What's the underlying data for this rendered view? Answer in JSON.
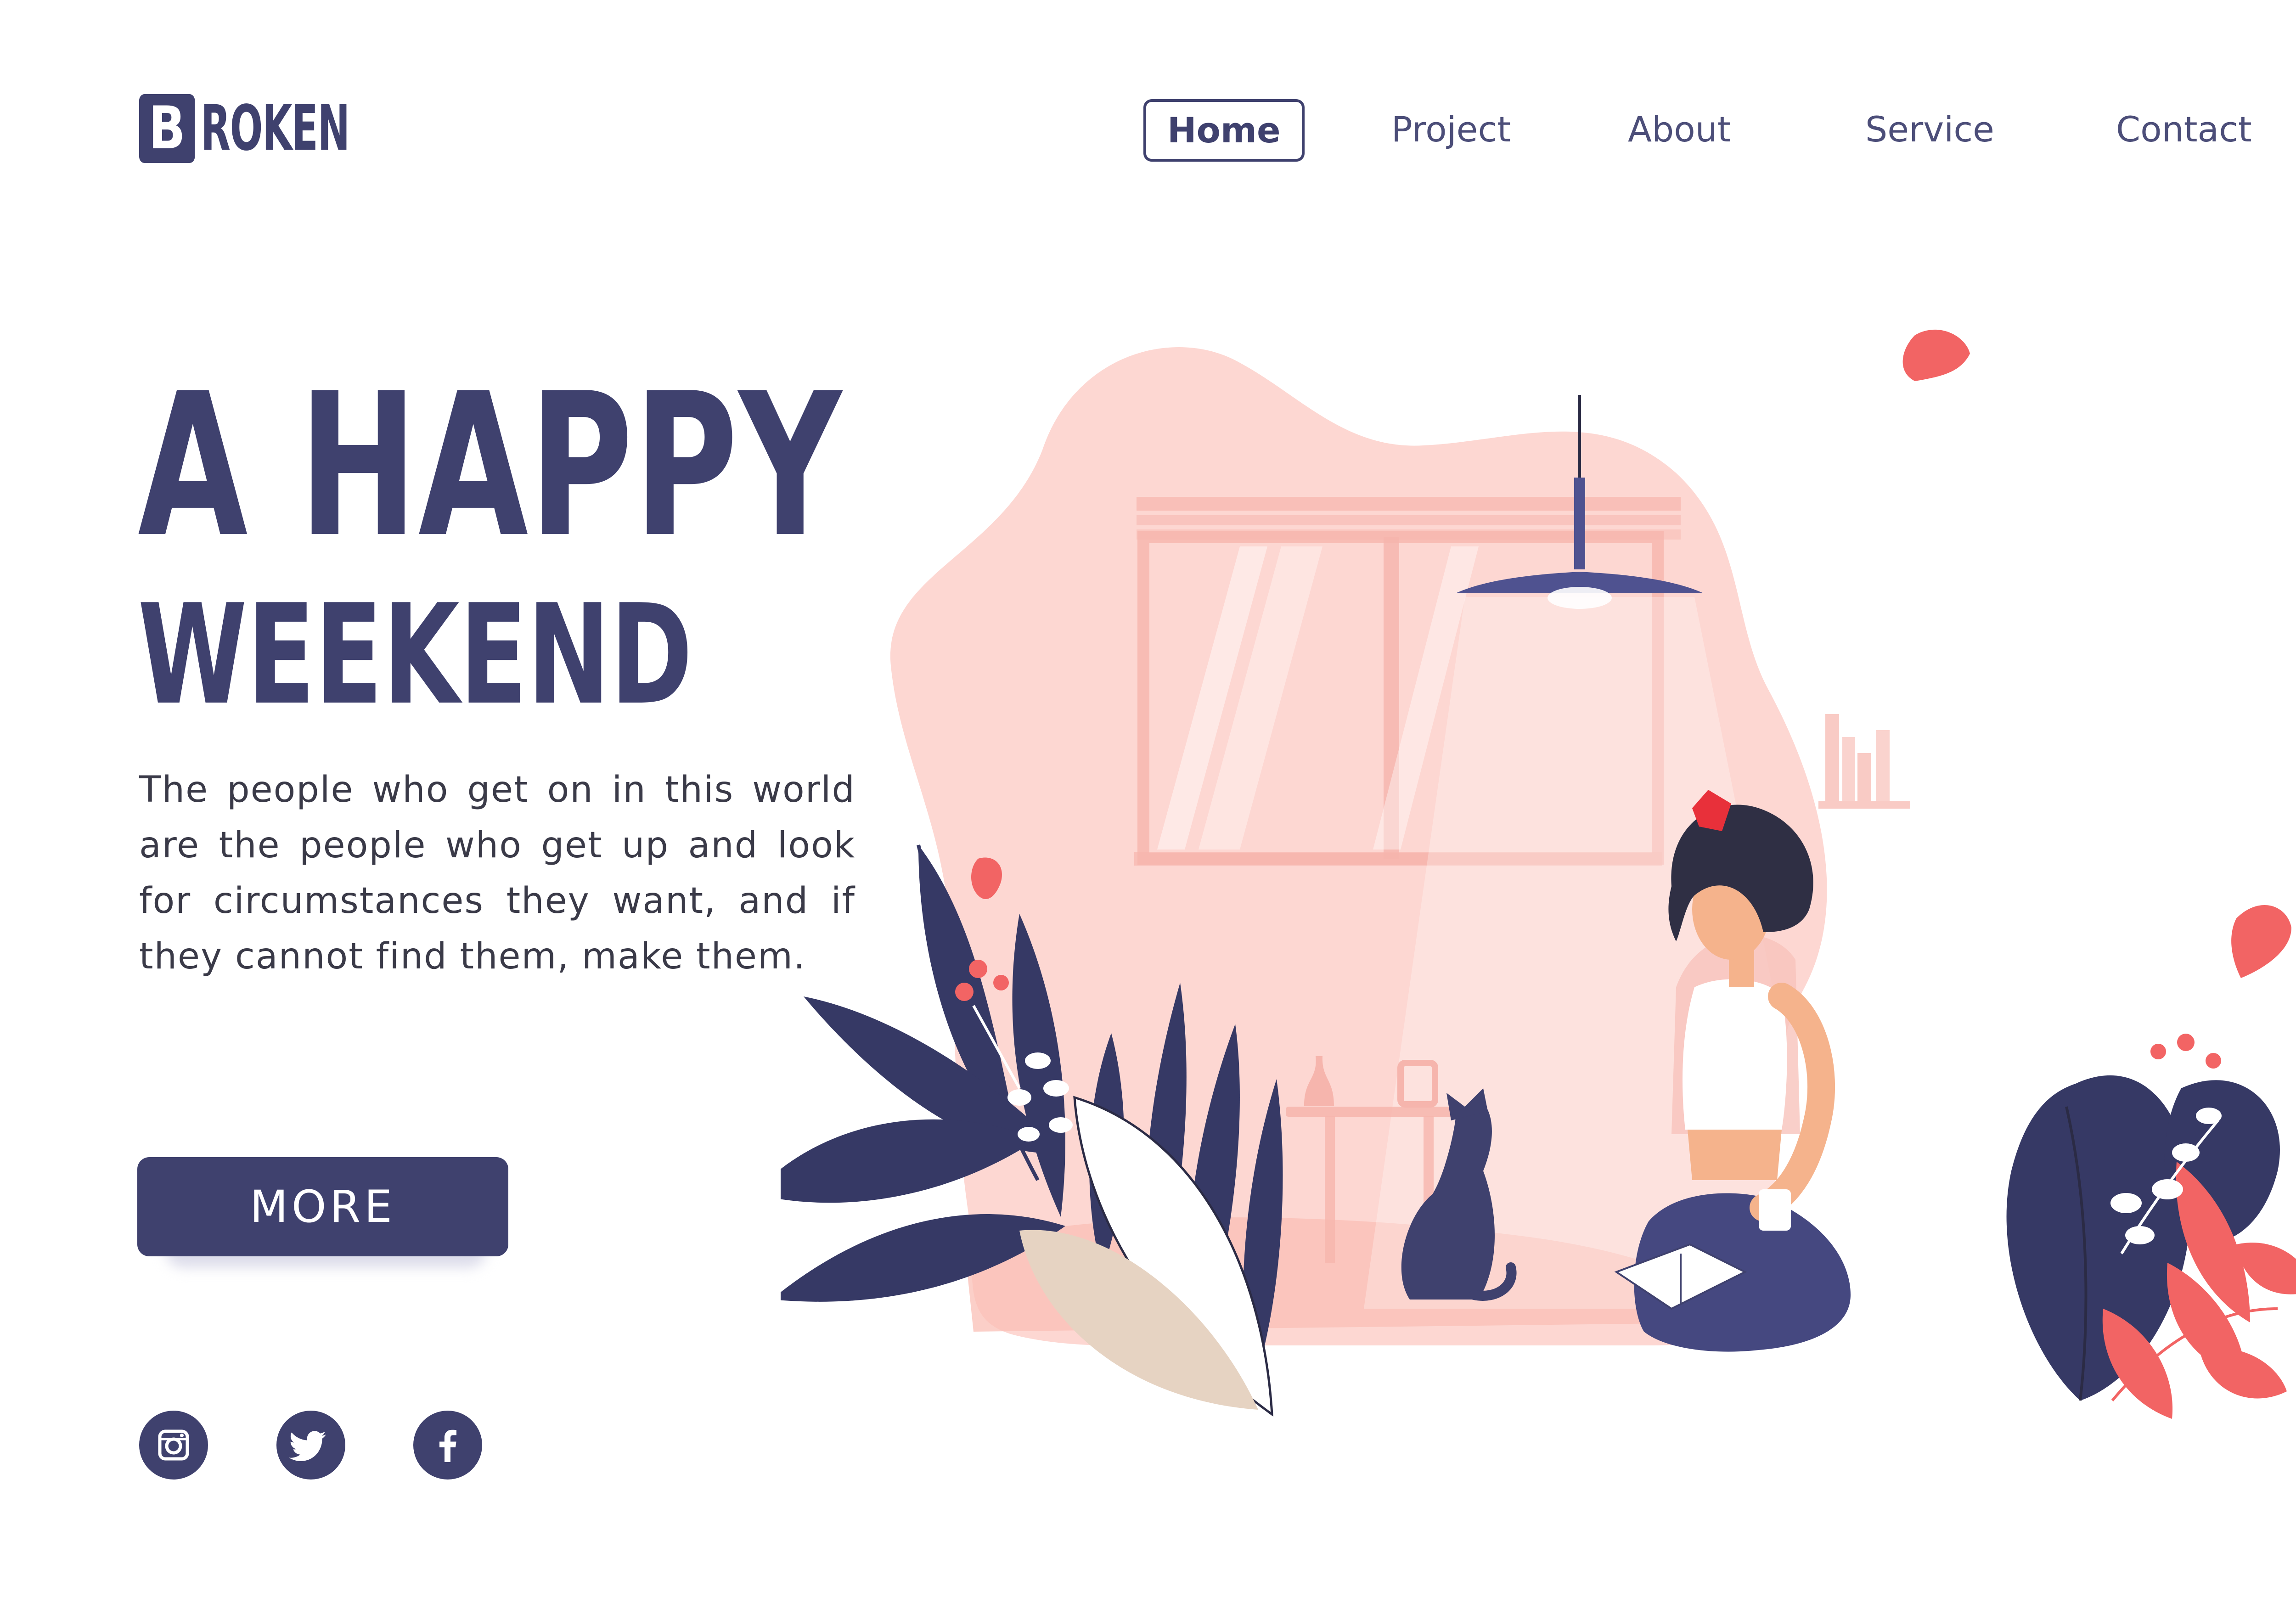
{
  "logo": {
    "mark": "B",
    "word": "ROKEN"
  },
  "nav": {
    "items": [
      {
        "label": "Home",
        "active": true
      },
      {
        "label": "Project",
        "active": false
      },
      {
        "label": "About",
        "active": false
      },
      {
        "label": "Service",
        "active": false
      },
      {
        "label": "Contact",
        "active": false
      }
    ]
  },
  "hero": {
    "title_line1": "A HAPPY",
    "title_line2": "WEEKEND",
    "paragraph": "The people who get on in this world are the people who get up and look for circumstances they want, and if they cannot find them, make them.",
    "button_label": "MORE"
  },
  "socials": [
    {
      "icon": "instagram-icon"
    },
    {
      "icon": "twitter-icon"
    },
    {
      "icon": "facebook-icon"
    }
  ],
  "colors": {
    "primary": "#3f416e",
    "accent": "#f26464",
    "blob": "#fcd3cd",
    "text": "#3a3a48"
  }
}
